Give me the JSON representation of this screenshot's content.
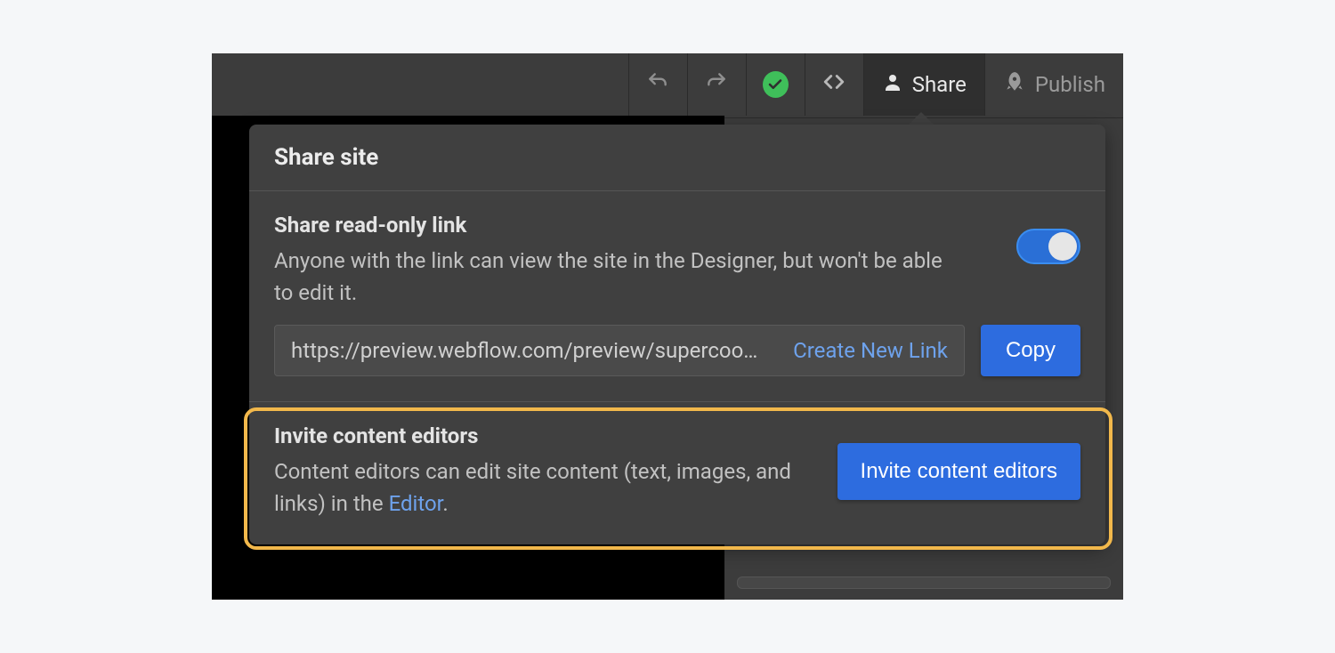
{
  "topbar": {
    "share_label": "Share",
    "publish_label": "Publish"
  },
  "popover": {
    "title": "Share site",
    "readonly": {
      "heading": "Share read-only link",
      "description": "Anyone with the link can view the site in the Designer, but won't be able to edit it.",
      "url": "https://preview.webflow.com/preview/supercoo…",
      "create_new_link_label": "Create New Link",
      "copy_label": "Copy",
      "toggle_on": true
    },
    "invite": {
      "heading": "Invite content editors",
      "description_pre": "Content editors can edit site content (text, images, and links) in the ",
      "editor_link_label": "Editor",
      "description_post": ".",
      "button_label": "Invite content editors"
    }
  }
}
